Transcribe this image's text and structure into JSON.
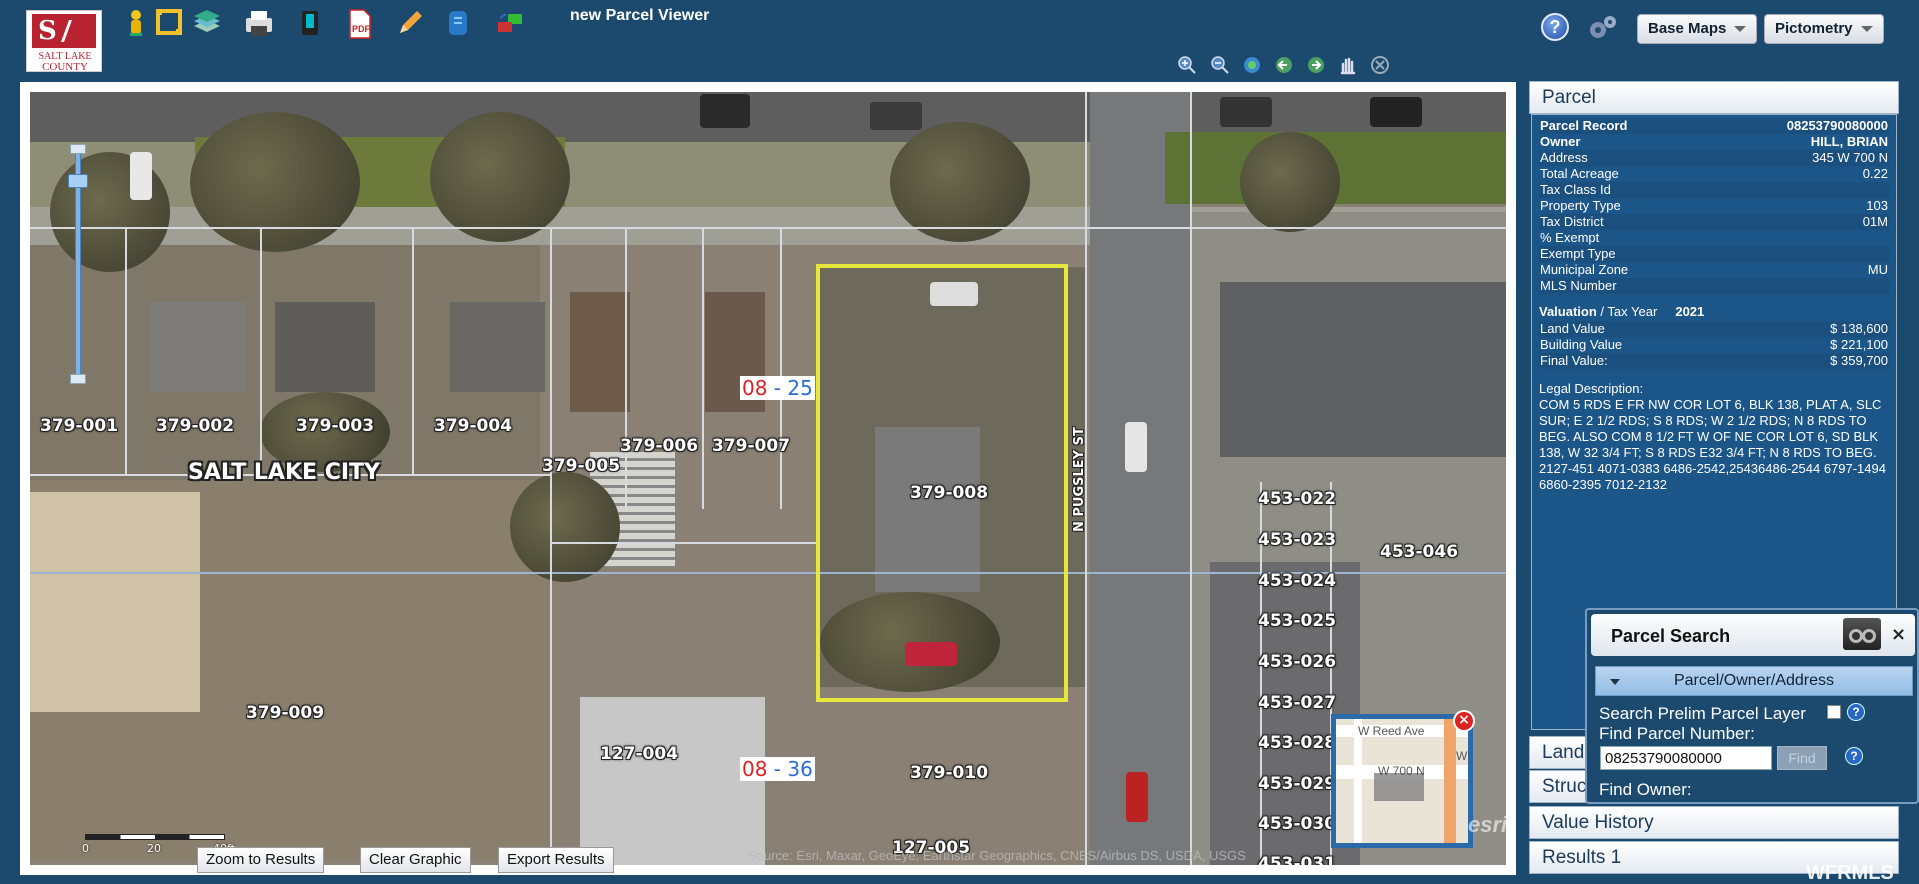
{
  "header": {
    "logo_line1": "SALT LAKE",
    "logo_line2": "COUNTY",
    "title": "new Parcel Viewer",
    "help": "?",
    "base_maps_label": "Base Maps",
    "pictometry_label": "Pictometry",
    "toolbar_icons": [
      "locate-person-icon",
      "frame-icon",
      "layers-icon",
      "print-icon",
      "bookmark-icon",
      "pdf-icon",
      "pencil-icon",
      "document-icon",
      "transfer-icon"
    ],
    "nav_icons": [
      "zoom-in-icon",
      "zoom-out-icon",
      "full-extent-icon",
      "previous-extent-icon",
      "next-extent-icon",
      "pan-icon",
      "deactivate-icon"
    ]
  },
  "map": {
    "city_label": "SALT LAKE CITY",
    "street_label": "N PUGSLEY ST",
    "parcels": [
      "379-001",
      "379-002",
      "379-003",
      "379-004",
      "379-005",
      "379-006",
      "379-007",
      "379-008",
      "379-009",
      "379-010",
      "127-004",
      "127-005",
      "453-022",
      "453-023",
      "453-024",
      "453-025",
      "453-026",
      "453-027",
      "453-028",
      "453-029",
      "453-030",
      "453-031",
      "453-046"
    ],
    "block_numbers": [
      {
        "left": "08",
        "right": "25"
      },
      {
        "left": "08",
        "right": "36"
      }
    ],
    "scale_labels": [
      "0",
      "20",
      "40ft"
    ],
    "attribution": "Source: Esri, Maxar, GeoEye, Earthstar Geographics, CNES/Airbus DS, USDA, USGS",
    "esri": "esri",
    "overview": {
      "street1": "W Reed Ave",
      "street2": "W 700 N",
      "street3": "W"
    },
    "buttons": {
      "zoom": "Zoom to Results",
      "clear": "Clear Graphic",
      "export": "Export Results"
    }
  },
  "panel": {
    "parcel_title": "Parcel",
    "record": [
      {
        "k": "Parcel Record",
        "v": "08253790080000",
        "bold": true
      },
      {
        "k": "Owner",
        "v": "HILL, BRIAN",
        "bold": true
      },
      {
        "k": "Address",
        "v": "345 W 700 N"
      },
      {
        "k": "Total Acreage",
        "v": "0.22"
      },
      {
        "k": "Tax Class Id",
        "v": ""
      },
      {
        "k": "Property Type",
        "v": "103"
      },
      {
        "k": "Tax District",
        "v": "01M"
      },
      {
        "k": "% Exempt",
        "v": ""
      },
      {
        "k": "Exempt Type",
        "v": ""
      },
      {
        "k": "Municipal Zone",
        "v": "MU"
      },
      {
        "k": "MLS Number",
        "v": ""
      }
    ],
    "valuation_label": "Valuation",
    "taxyear_label": " / Tax Year",
    "tax_year": "2021",
    "values": [
      {
        "k": "Land Value",
        "v": "$ 138,600"
      },
      {
        "k": "Building Value",
        "v": "$ 221,100"
      },
      {
        "k": "Final Value:",
        "v": "$ 359,700"
      }
    ],
    "legal_label": "Legal Description:",
    "legal_text": "COM 5 RDS E FR NW COR LOT 6, BLK 138, PLAT A, SLC SUR; E 2 1/2 RDS; S 8 RDS; W 2 1/2 RDS; N 8 RDS TO BEG. ALSO COM 8 1/2 FT W OF NE COR LOT 6, SD BLK 138, W 32 3/4 FT; S 8 RDS E32 3/4 FT; N 8 RDS TO BEG. 2127-451 4071-0383 6486-2542,25436486-2544 6797-1494 6860-2395 7012-2132",
    "sections": [
      "Land",
      "Struc",
      "Value History",
      "Results 1"
    ]
  },
  "search": {
    "title": "Parcel Search",
    "close": "×",
    "tab_label": "Parcel/Owner/Address",
    "prelim_label": "Search Prelim Parcel Layer",
    "find_number_label": "Find Parcel Number:",
    "parcel_number_value": "08253790080000",
    "find_button": "Find",
    "find_owner_label": "Find Owner:"
  },
  "watermark": "WFRMLS"
}
